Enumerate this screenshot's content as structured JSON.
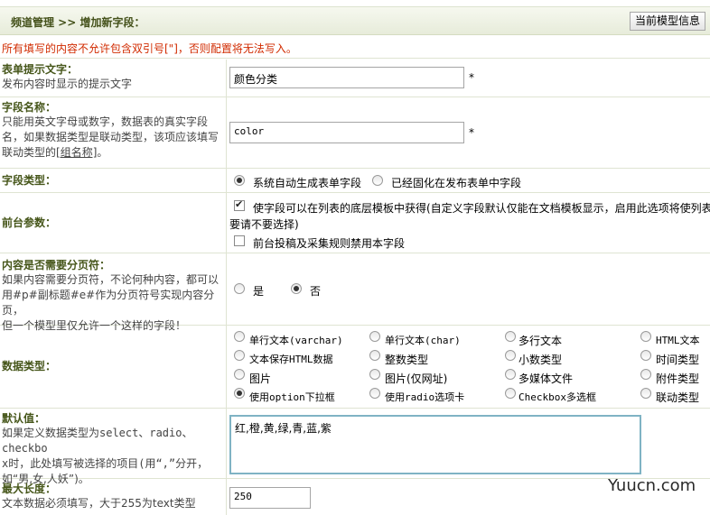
{
  "header": {
    "breadcrumb": "频道管理 >> 增加新字段：",
    "model_info_button": "当前模型信息"
  },
  "warning": "所有填写的内容不允许包含双引号[\"]，否则配置将无法写入。",
  "fields": {
    "form_tip": {
      "label": "表单提示文字：",
      "desc": "发布内容时显示的提示文字",
      "value": "颜色分类",
      "required": "*"
    },
    "field_name": {
      "label": "字段名称：",
      "desc_lines": [
        "只能用英文字母或数字，数据表的真实字段",
        "名，如果数据类型是联动类型，该项应该填写",
        "联动类型的"
      ],
      "link": "[组名称]",
      "desc_end": "。",
      "value": "color",
      "required": "*"
    },
    "field_type": {
      "label": "字段类型：",
      "options": [
        "系统自动生成表单字段",
        "已经固化在发布表单中字段"
      ]
    },
    "frontend": {
      "label": "前台参数：",
      "option1_line1": "使字段可以在列表的底层模板中获得(自定义字段默认仅能在文档模板显示，启用此选项将使列表",
      "option1_line2": "要请不要选择)",
      "option2": "前台投稿及采集规则禁用本字段"
    },
    "paging": {
      "label": "内容是否需要分页符：",
      "desc_lines": [
        "如果内容需要分页符，不论何种内容，都可以",
        "用#p#副标题#e#作为分页符号实现内容分页，",
        "但一个模型里仅允许一个这样的字段！"
      ],
      "options": [
        "是",
        "否"
      ]
    },
    "data_type": {
      "label": "数据类型：",
      "options": [
        [
          "单行文本(varchar)",
          "单行文本(char)",
          "多行文本",
          "HTML文本"
        ],
        [
          "文本保存HTML数据",
          "整数类型",
          "小数类型",
          "时间类型"
        ],
        [
          "图片",
          "图片(仅网址)",
          "多媒体文件",
          "附件类型"
        ],
        [
          "使用option下拉框",
          "使用radio选项卡",
          "Checkbox多选框",
          "联动类型"
        ]
      ]
    },
    "default_value": {
      "label": "默认值：",
      "desc_lines": [
        "如果定义数据类型为select、radio、checkbo",
        "x时，此处填写被选择的项目(用“,”分开，",
        "如“男,女,人妖”)。"
      ],
      "value": "红,橙,黄,绿,青,蓝,紫"
    },
    "max_length": {
      "label": "最大长度：",
      "desc": "文本数据必须填写，大于255为text类型",
      "value": "250"
    }
  },
  "watermark": "Yuucn.com"
}
